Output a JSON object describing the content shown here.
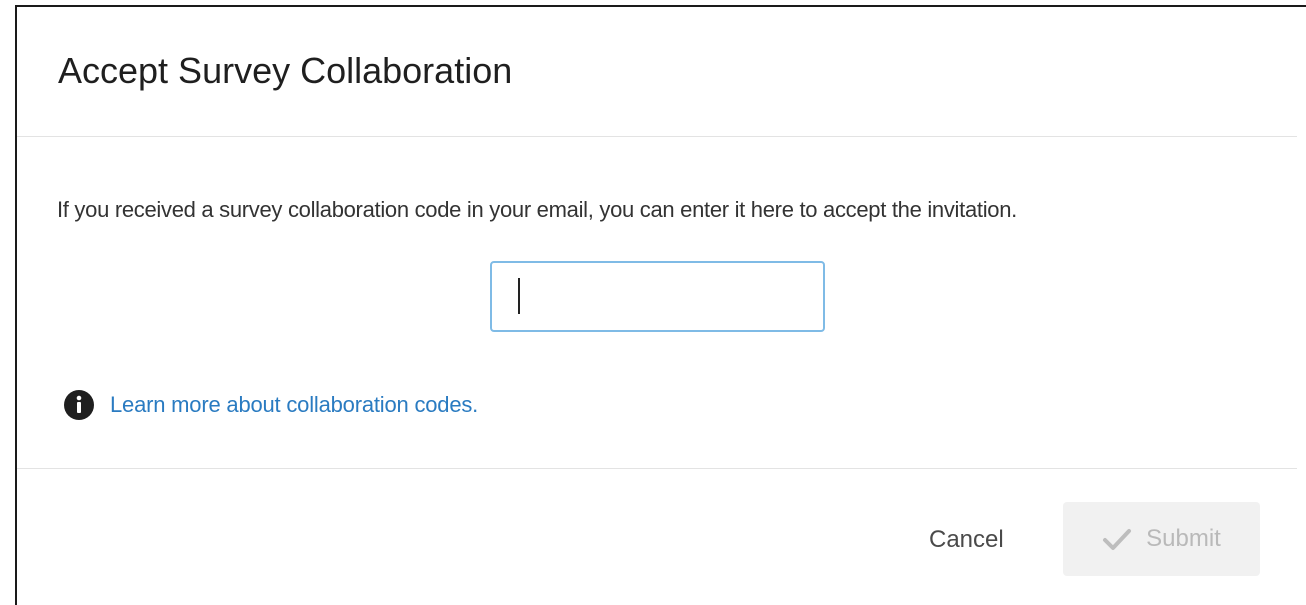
{
  "dialog": {
    "title": "Accept Survey Collaboration",
    "instruction": "If you received a survey collaboration code in your email, you can enter it here to accept the invitation.",
    "code_input": {
      "value": "",
      "placeholder": ""
    },
    "learn_more_link": "Learn more about collaboration codes.",
    "footer": {
      "cancel_label": "Cancel",
      "submit_label": "Submit"
    }
  },
  "icons": {
    "info": "info-icon",
    "submit": "checkmark-icon"
  },
  "colors": {
    "link": "#2a7bc1",
    "input_focus_border": "#7fbbe6",
    "submit_disabled_bg": "#f1f1f1",
    "submit_disabled_text": "#b9b9b9"
  }
}
